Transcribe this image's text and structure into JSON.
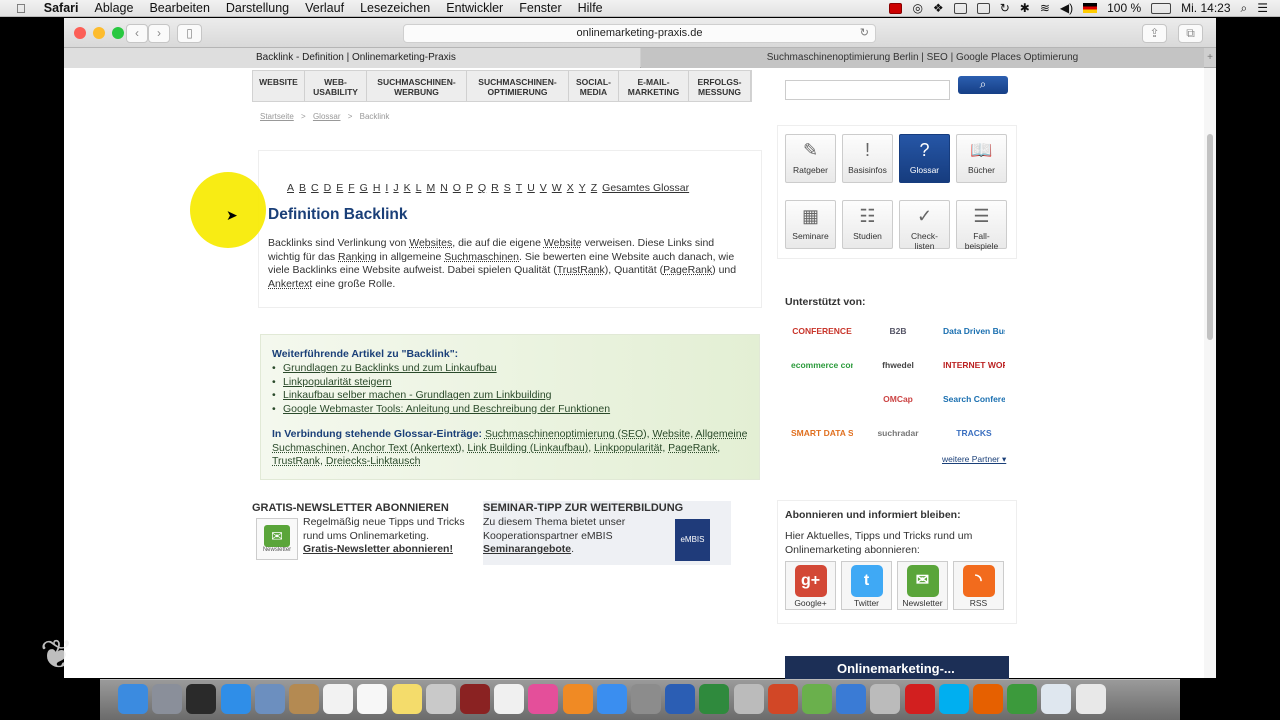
{
  "menubar": {
    "apple": "",
    "items": [
      "Safari",
      "Ablage",
      "Bearbeiten",
      "Darstellung",
      "Verlauf",
      "Lesezeichen",
      "Entwickler",
      "Fenster",
      "Hilfe"
    ],
    "battery": "100 %",
    "clock": "Mi. 14:23"
  },
  "browser": {
    "url": "onlinemarketing-praxis.de",
    "tabs": [
      {
        "label": "Backlink - Definition | Onlinemarketing-Praxis",
        "active": true
      },
      {
        "label": "Suchmaschinenoptimierung Berlin | SEO | Google Places Optimierung",
        "active": false
      }
    ],
    "back_glyph": "‹",
    "forward_glyph": "›"
  },
  "nav": {
    "items": [
      "WEBSITE",
      "WEB-\nUSABILITY",
      "SUCHMASCHINEN-\nWERBUNG",
      "SUCHMASCHINEN-\nOPTIMIERUNG",
      "SOCIAL-\nMEDIA",
      "E-MAIL-\nMARKETING",
      "ERFOLGS-\nMESSUNG"
    ]
  },
  "search": {
    "placeholder": "",
    "button_icon": "search-icon"
  },
  "breadcrumb": {
    "home": "Startseite",
    "sep": ">",
    "glossar": "Glossar",
    "current": "Backlink"
  },
  "alphabet": [
    "A",
    "B",
    "C",
    "D",
    "E",
    "F",
    "G",
    "H",
    "I",
    "J",
    "K",
    "L",
    "M",
    "N",
    "O",
    "P",
    "Q",
    "R",
    "S",
    "T",
    "U",
    "V",
    "W",
    "X",
    "Y",
    "Z",
    "Gesamtes Glossar"
  ],
  "article": {
    "title": "Definition Backlink",
    "body": [
      {
        "t": "Backlinks sind Verlinkung von "
      },
      {
        "t": "Websites",
        "u": 1
      },
      {
        "t": ", die auf die eigene "
      },
      {
        "t": "Website",
        "u": 1
      },
      {
        "t": " verweisen. Diese Links sind wichtig für das "
      },
      {
        "t": "Ranking",
        "u": 1
      },
      {
        "t": " in allgemeine "
      },
      {
        "t": "Suchmaschinen",
        "u": 1
      },
      {
        "t": ". Sie bewerten eine Website auch danach, wie viele Backlinks eine Website aufweist. Dabei spielen Qualität ("
      },
      {
        "t": "TrustRank",
        "u": 1
      },
      {
        "t": "), Quantität ("
      },
      {
        "t": "PageRank",
        "u": 1
      },
      {
        "t": ") und "
      },
      {
        "t": "Ankertext",
        "u": 1
      },
      {
        "t": " eine große Rolle."
      }
    ]
  },
  "further": {
    "heading": "Weiterführende Artikel zu \"Backlink\":",
    "items": [
      "Grundlagen zu Backlinks und zum Linkaufbau",
      "Linkpopularität steigern",
      "Linkaufbau selber machen - Grundlagen zum Linkbuilding",
      "Google Webmaster Tools: Anleitung und Beschreibung der Funktionen"
    ],
    "related_label": "In Verbindung stehende Glossar-Einträge:",
    "related": [
      "Suchmaschinenoptimierung (SEO)",
      "Website",
      "Allgemeine Suchmaschinen",
      "Anchor Text (Ankertext)",
      "Link Building (Linkaufbau)",
      "Linkpopularität",
      "PageRank",
      "TrustRank",
      "Dreiecks-Linktausch"
    ]
  },
  "newsletter": {
    "heading": "GRATIS-NEWSLETTER ABONNIEREN",
    "icon_label": "Newsletter",
    "text": "Regelmäßig neue Tipps und Tricks rund ums Onlinemarketing.",
    "link": "Gratis-Newsletter abonnieren!"
  },
  "seminar": {
    "heading": "SEMINAR-TIPP ZUR WEITERBILDUNG",
    "text": "Zu diesem Thema bietet unser Kooperationspartner eMBIS",
    "link": "Seminarangebote",
    "suffix": ".",
    "logo": "eMBIS"
  },
  "tiles": [
    {
      "label": "Ratgeber",
      "icon": "guide-icon",
      "glyph": "✎"
    },
    {
      "label": "Basisinfos",
      "icon": "exclamation-icon",
      "glyph": "!"
    },
    {
      "label": "Glossar",
      "icon": "question-icon",
      "glyph": "?",
      "active": true
    },
    {
      "label": "Bücher",
      "icon": "book-icon",
      "glyph": "📖"
    },
    {
      "label": "Seminare",
      "icon": "presentation-icon",
      "glyph": "▦"
    },
    {
      "label": "Studien",
      "icon": "study-icon",
      "glyph": "☷"
    },
    {
      "label": "Check-\nlisten",
      "icon": "checkmark-icon",
      "glyph": "✓"
    },
    {
      "label": "Fall-\nbeispiele",
      "icon": "document-icon",
      "glyph": "☰"
    }
  ],
  "supporters": {
    "heading": "Unterstützt von:",
    "partners": [
      "CONFERENCE",
      "B2B",
      "Data Driven Business",
      "ecommerce conference",
      "fhwedel",
      "INTERNET WORLD Business",
      "",
      "OMCap",
      "Search Conference",
      "SMART DATA Summit",
      "suchradar",
      "TRACKS"
    ],
    "more": "weitere Partner ▾"
  },
  "subscribe": {
    "heading": "Abonnieren und informiert bleiben:",
    "text": "Hier Aktuelles, Tipps und Tricks rund um Onlinemarketing abonnieren:",
    "items": [
      {
        "label": "Google+",
        "icon": "google-plus-icon",
        "glyph": "g+",
        "color": "#d34836"
      },
      {
        "label": "Twitter",
        "icon": "twitter-icon",
        "glyph": "t",
        "color": "#3fa9f5"
      },
      {
        "label": "Newsletter",
        "icon": "newsletter-icon",
        "glyph": "✉",
        "color": "#5aa53a"
      },
      {
        "label": "RSS",
        "icon": "rss-icon",
        "glyph": "◝",
        "color": "#f26b1d"
      }
    ]
  },
  "banner": {
    "text": "Onlinemarketing-..."
  },
  "dock": [
    {
      "icon": "finder-icon",
      "color": "#3b8be0"
    },
    {
      "icon": "launchpad-icon",
      "color": "#8a8f9a"
    },
    {
      "icon": "mission-control-icon",
      "color": "#2a2a2a"
    },
    {
      "icon": "safari-icon",
      "color": "#2f8ee8"
    },
    {
      "icon": "preview-icon",
      "color": "#6c8fbf"
    },
    {
      "icon": "contacts-icon",
      "color": "#b48a52"
    },
    {
      "icon": "calendar-icon",
      "color": "#f2f2f2"
    },
    {
      "icon": "reminders-icon",
      "color": "#f7f7f7"
    },
    {
      "icon": "notes-icon",
      "color": "#f4dc6b"
    },
    {
      "icon": "image-capture-icon",
      "color": "#c9c9c9"
    },
    {
      "icon": "photo-booth-icon",
      "color": "#8a2222"
    },
    {
      "icon": "photos-icon",
      "color": "#f0f0f0"
    },
    {
      "icon": "itunes-icon",
      "color": "#e44f9a"
    },
    {
      "icon": "ibooks-icon",
      "color": "#f08a24"
    },
    {
      "icon": "app-store-icon",
      "color": "#3a8ef0"
    },
    {
      "icon": "system-preferences-icon",
      "color": "#8c8c8c"
    },
    {
      "icon": "word-icon",
      "color": "#2b5eb4"
    },
    {
      "icon": "excel-icon",
      "color": "#2f8a3d"
    },
    {
      "icon": "unknown-app-icon",
      "color": "#bbbbbb"
    },
    {
      "icon": "powerpoint-icon",
      "color": "#d24726"
    },
    {
      "icon": "messenger-icon",
      "color": "#6ab04c"
    },
    {
      "icon": "network-icon",
      "color": "#3a7bd5"
    },
    {
      "icon": "unknown-app-icon",
      "color": "#bbbbbb"
    },
    {
      "icon": "acrobat-icon",
      "color": "#d21f1f"
    },
    {
      "icon": "skype-icon",
      "color": "#00aff0"
    },
    {
      "icon": "firefox-icon",
      "color": "#e66000"
    },
    {
      "icon": "camtasia-icon",
      "color": "#3c9a3c"
    },
    {
      "icon": "folder-icon",
      "color": "#dfe7ef"
    },
    {
      "icon": "trash-icon",
      "color": "#e8e8e8"
    }
  ]
}
